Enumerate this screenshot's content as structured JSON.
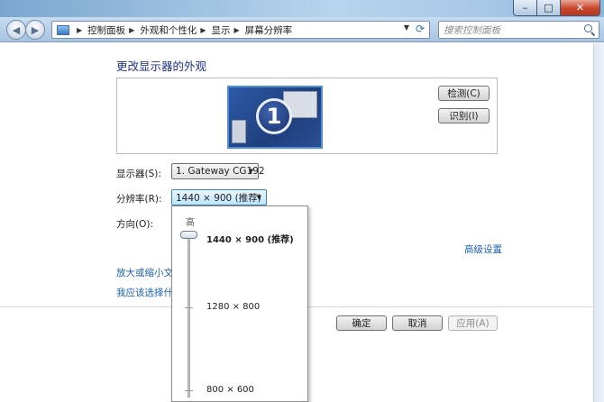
{
  "window": {
    "min_glyph": "–",
    "max_glyph": "□",
    "close_glyph": "✕"
  },
  "address_bar": {
    "breadcrumbs": [
      "控制面板",
      "外观和个性化",
      "显示",
      "屏幕分辨率"
    ]
  },
  "search": {
    "placeholder": "搜索控制面板"
  },
  "page": {
    "title": "更改显示器的外观",
    "monitor_number": "1",
    "detect_label": "检测(C)",
    "identify_label": "识别(I)"
  },
  "settings": {
    "display_label": "显示器(S):",
    "display_value": "1. Gateway CG192",
    "resolution_label": "分辨率(R):",
    "resolution_value": "1440 × 900 (推荐)",
    "orientation_label": "方向(O):"
  },
  "links": {
    "advanced": "高级设置",
    "enlarge_text": "放大或缩小文本",
    "which_settings": "我应该选择什么"
  },
  "footer": {
    "ok_label": "确定",
    "cancel_label": "取消",
    "apply_label": "应用(A)"
  },
  "resolution_popup": {
    "high_label": "高",
    "slider_level": 0,
    "options": [
      "1440 × 900 (推荐)",
      "1280 × 800",
      "800 × 600"
    ]
  }
}
